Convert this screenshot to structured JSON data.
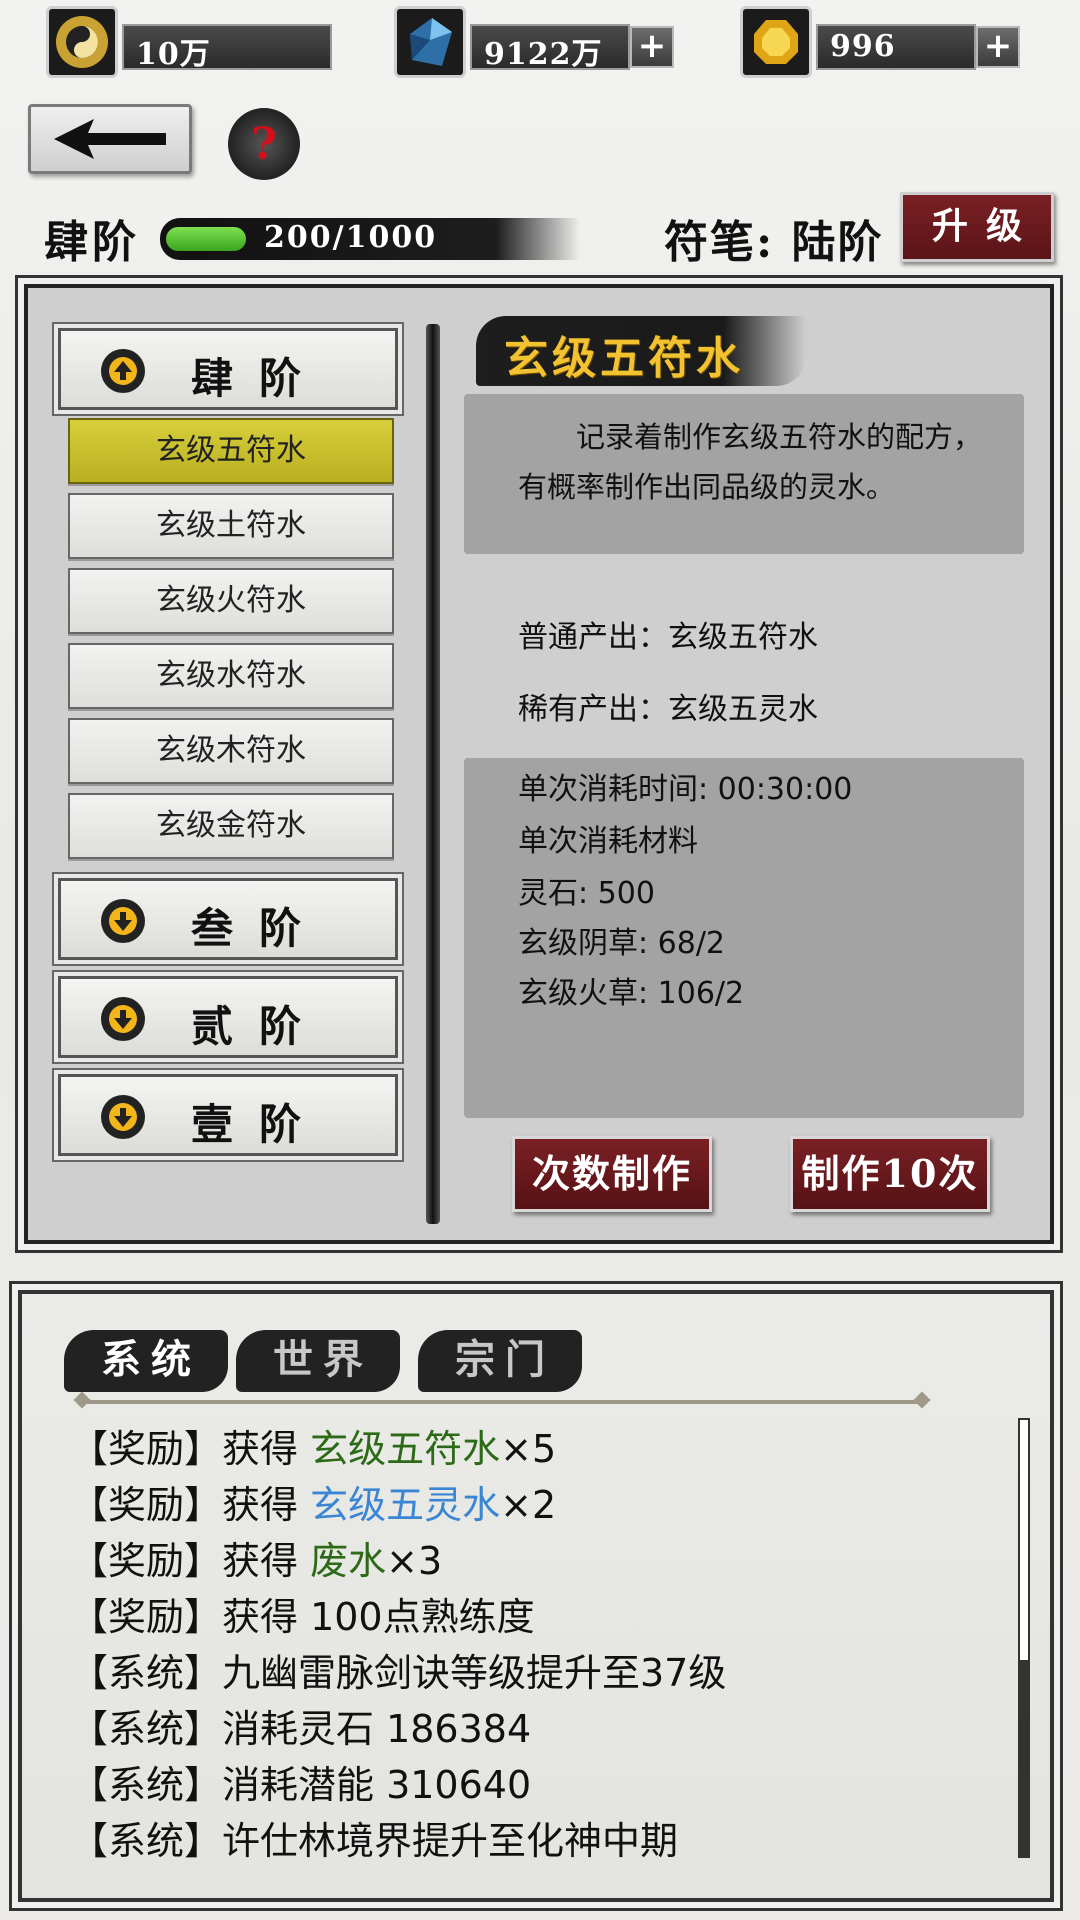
{
  "resources": {
    "taiji_value": "10万",
    "crystal_value": "9122万",
    "gold_value": "996",
    "plus_label": "+"
  },
  "header": {
    "help_label": "?",
    "rank_label": "肆阶",
    "progress_text": "200/1000",
    "progress_fraction": 0.2,
    "brush_label": "符笔: 陆阶",
    "upgrade_label": "升级"
  },
  "tiers": [
    {
      "label": "肆阶",
      "expanded": true
    },
    {
      "label": "叁阶",
      "expanded": false
    },
    {
      "label": "贰阶",
      "expanded": false
    },
    {
      "label": "壹阶",
      "expanded": false
    }
  ],
  "recipes": [
    "玄级五符水",
    "玄级土符水",
    "玄级火符水",
    "玄级水符水",
    "玄级木符水",
    "玄级金符水"
  ],
  "selected_recipe": 0,
  "detail": {
    "title": "玄级五符水",
    "description": "记录着制作玄级五符水的配方，有概率制作出同品级的灵水。",
    "normal_output": "普通产出：玄级五符水",
    "rare_output": "稀有产出：玄级五灵水",
    "time": "单次消耗时间: 00:30:00",
    "materials_header": "单次消耗材料",
    "mat1": "灵石: 500",
    "mat2": "玄级阴草: 68/2",
    "mat3": "玄级火草: 106/2",
    "btn_count": "次数制作",
    "btn_ten": "制作10次"
  },
  "log": {
    "tabs": [
      "系统",
      "世界",
      "宗门"
    ],
    "l1a": "【奖励】获得 ",
    "l1b": "玄级五符水",
    "l1c": "×5",
    "l2a": "【奖励】获得 ",
    "l2b": "玄级五灵水",
    "l2c": "×2",
    "l3a": "【奖励】获得 ",
    "l3b": "废水",
    "l3c": "×3",
    "l4": "【奖励】获得 100点熟练度",
    "l5": "【系统】九幽雷脉剑诀等级提升至37级",
    "l6": "【系统】消耗灵石 186384",
    "l7": "【系统】消耗潜能 310640",
    "l8": "【系统】许仕林境界提升至化神中期"
  },
  "colors": {
    "green_item": "#2d6a18",
    "blue_item": "#3b86d4",
    "selected_recipe": "#c9bf2e",
    "button_red": "#6e1b1f"
  }
}
